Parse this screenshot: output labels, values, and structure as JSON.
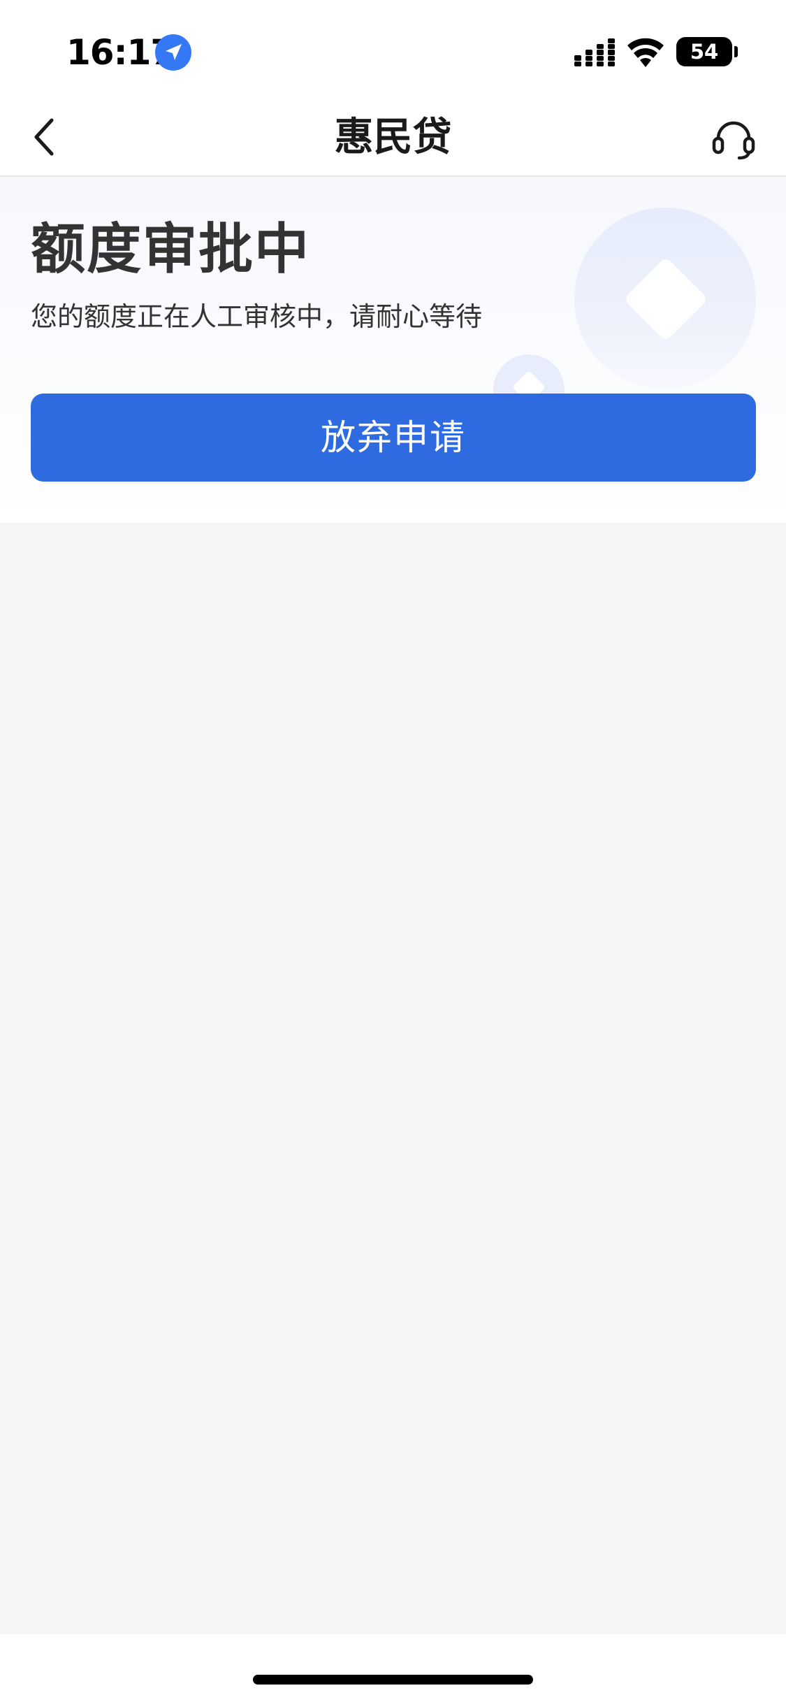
{
  "status_bar": {
    "time": "16:17",
    "battery": "54",
    "location_icon": "location-arrow-icon",
    "signal_icon": "cellular-signal-icon",
    "wifi_icon": "wifi-icon"
  },
  "nav": {
    "title": "惠民贷",
    "back_icon": "chevron-left-icon",
    "support_icon": "headset-icon"
  },
  "approval": {
    "title": "额度审批中",
    "description": "您的额度正在人工审核中，请耐心等待",
    "abandon_button": "放弃申请"
  },
  "colors": {
    "primary": "#2e6ae0",
    "page_background": "#f5f5f6",
    "text": "#333333"
  }
}
